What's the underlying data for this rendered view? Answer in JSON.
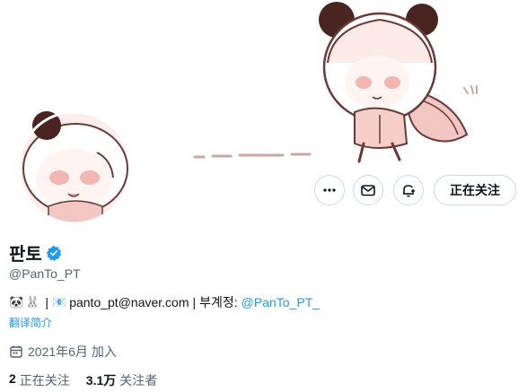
{
  "actions": {
    "more_icon": "more-dots-icon",
    "message_icon": "envelope-icon",
    "notify_icon": "bell-plus-icon",
    "follow_label": "正在关注"
  },
  "profile": {
    "display_name": "판토",
    "handle": "@PanTo_PT",
    "verified": true,
    "accent_color": "#1d9bf0"
  },
  "bio": {
    "emoji_1": "🐼",
    "emoji_2": "🐰",
    "sep_1": "|",
    "mail_emoji": "📧",
    "email": "panto_pt@naver.com",
    "sep_2": "|",
    "alt_label": "부계정:",
    "alt_mention": "@PanTo_PT_"
  },
  "translate_label": "翻译简介",
  "joined": "2021年6月 加入",
  "stats": {
    "following_count": "2",
    "following_label": "正在关注",
    "followers_count": "3.1万",
    "followers_label": "关注者"
  }
}
